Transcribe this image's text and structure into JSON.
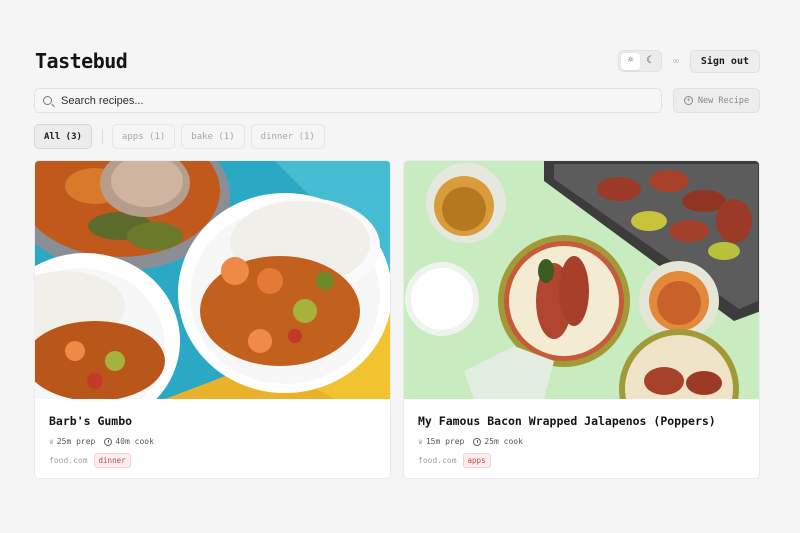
{
  "app": {
    "title": "Tastebud"
  },
  "header": {
    "theme_light_icon": "sun-icon",
    "theme_dark_icon": "moon-icon",
    "link_icon": "link-icon",
    "sign_out_label": "Sign out"
  },
  "search": {
    "placeholder": "Search recipes..."
  },
  "new_recipe": {
    "label": "New Recipe",
    "icon": "plus-circle-icon"
  },
  "filters": [
    {
      "label": "All (3)",
      "active": true
    },
    {
      "label": "apps (1)",
      "active": false
    },
    {
      "label": "bake (1)",
      "active": false
    },
    {
      "label": "dinner (1)",
      "active": false
    }
  ],
  "recipes": [
    {
      "title": "Barb's Gumbo",
      "prep": "25m prep",
      "cook": "40m cook",
      "source": "food.com",
      "tag": "dinner"
    },
    {
      "title": "My Famous Bacon Wrapped Jalapenos (Poppers)",
      "prep": "15m prep",
      "cook": "25m cook",
      "source": "food.com",
      "tag": "apps"
    }
  ],
  "colors": {
    "background": "#f5f5f5",
    "tag_text": "#c0484e",
    "tag_bg": "#fdeeee"
  }
}
